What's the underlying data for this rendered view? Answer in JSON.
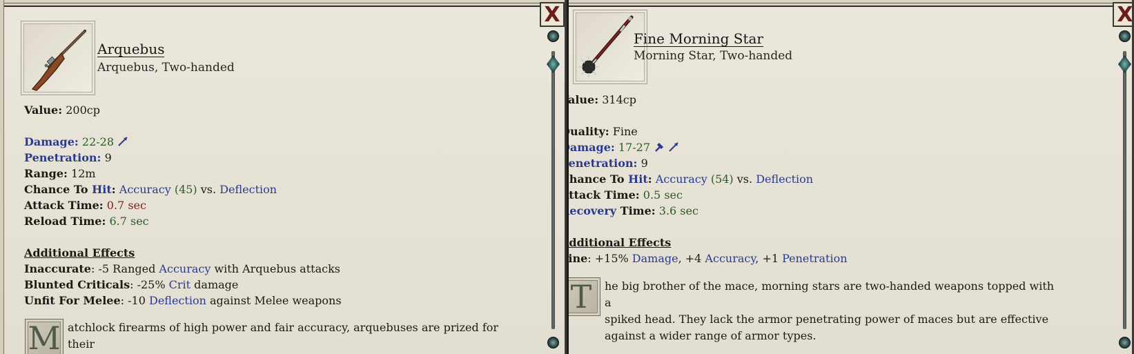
{
  "left": {
    "item_name": "Arquebus",
    "item_subtitle": "Arquebus, Two-handed",
    "icon": "arquebus-icon",
    "close_label": "X",
    "value_label": "Value:",
    "value": "200cp",
    "damage_label": "Damage:",
    "damage_value": "22-28",
    "damage_type_icon": "pierce-icon",
    "penetration_label": "Penetration:",
    "penetration_value": "9",
    "range_label": "Range:",
    "range_value": "12m",
    "chance_label_prefix": "Chance To ",
    "chance_label_hit": "Hit",
    "chance_colon": ":",
    "accuracy_word": "Accuracy",
    "accuracy_value": "(45)",
    "vs_word": "vs.",
    "deflection_word": "Deflection",
    "attack_time_label": "Attack Time:",
    "attack_time_value": "0.7 sec",
    "reload_time_label": "Reload Time:",
    "reload_time_value": "6.7 sec",
    "effects_heading": "Additional Effects",
    "effects": [
      {
        "name": "Inaccurate",
        "pre": ": -5 Ranged ",
        "kw": "Accuracy",
        "post": " with Arquebus attacks"
      },
      {
        "name": "Blunted Criticals",
        "pre": ": -25% ",
        "kw": "Crit",
        "post": " damage"
      },
      {
        "name": "Unfit For Melee",
        "pre": ": -10 ",
        "kw": "Deflection",
        "post": " against Melee weapons"
      }
    ],
    "desc_drop_cap": "M",
    "description": "atchlock firearms of high power and fair accuracy, arquebuses are prized for their"
  },
  "right": {
    "item_name": "Fine Morning Star",
    "item_subtitle": "Morning Star, Two-handed",
    "icon": "morning-star-icon",
    "close_label": "X",
    "value_label": "Value:",
    "value": "314cp",
    "quality_label": "Quality:",
    "quality_value": "Fine",
    "damage_label": "Damage:",
    "damage_value": "17-27",
    "damage_type_icons": [
      "crush-icon",
      "pierce-icon"
    ],
    "penetration_label": "Penetration:",
    "penetration_value": "9",
    "chance_label_prefix": "Chance To ",
    "chance_label_hit": "Hit",
    "chance_colon": ":",
    "accuracy_word": "Accuracy",
    "accuracy_value": "(54)",
    "vs_word": "vs.",
    "deflection_word": "Deflection",
    "attack_time_label": "Attack Time:",
    "attack_time_value": "0.5 sec",
    "recovery_word": "Recovery",
    "recovery_time_label": " Time:",
    "recovery_time_value": "3.6 sec",
    "effects_heading": "Additional Effects",
    "fine_label": "Fine",
    "fine_pre": ": +15% ",
    "fine_kw1": "Damage",
    "fine_mid1": ", +4 ",
    "fine_kw2": "Accuracy",
    "fine_mid2": ", +1 ",
    "fine_kw3": "Penetration",
    "desc_drop_cap": "T",
    "description_lines": [
      "he big brother of the mace, morning stars are two-handed weapons topped with a",
      "spiked head. They lack the armor penetrating power of maces but are effective",
      "against a wider range of armor types."
    ]
  },
  "colors": {
    "keyword": "#2b3a8f",
    "positive": "#2e5a26",
    "negative": "#7a2418",
    "parchment": "#e8e4d8",
    "close_x": "#6b1d19"
  }
}
